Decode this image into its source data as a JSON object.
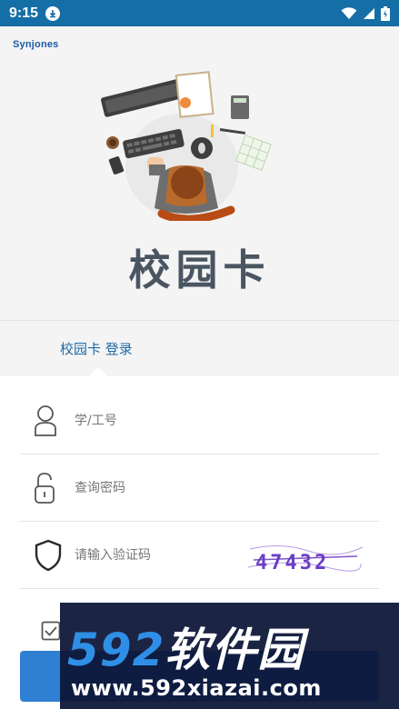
{
  "status_bar": {
    "time": "9:15"
  },
  "hero": {
    "brand": "Synjones",
    "app_title": "校园卡"
  },
  "tabs": {
    "login_label": "校园卡 登录"
  },
  "form": {
    "username_placeholder": "学/工号",
    "password_placeholder": "查询密码",
    "captcha_placeholder": "请输入验证码",
    "captcha_code": "47432"
  },
  "watermark": {
    "digits": "592",
    "name": "软件园",
    "url": "www.592xiazai.com"
  },
  "colors": {
    "status_bar": "#156ea6",
    "accent": "#1f6aa6",
    "login_button": "#2f7fd2",
    "watermark_bg": "#0e1638",
    "watermark_digits": "#2f8fe6"
  }
}
